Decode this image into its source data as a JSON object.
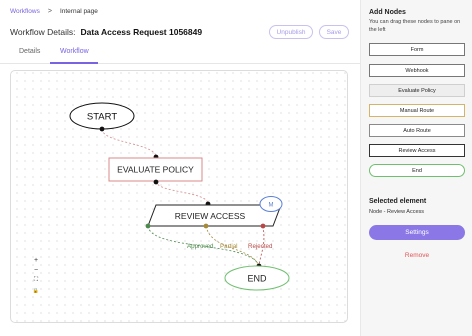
{
  "breadcrumb": {
    "parent": "Workflows",
    "separator": ">",
    "current": "Internal page"
  },
  "header": {
    "title_label": "Workflow Details:",
    "title_value": "Data Access Request 1056849",
    "unpublish_label": "Unpublish",
    "save_label": "Save"
  },
  "tabs": [
    {
      "label": "Details"
    },
    {
      "label": "Workflow"
    }
  ],
  "active_tab": "Workflow",
  "canvas": {
    "nodes": {
      "start": "START",
      "evaluate": "EVALUATE POLICY",
      "review": "REVIEW ACCESS",
      "end": "END",
      "review_badge": "M"
    },
    "edge_labels": {
      "approved": "Approved",
      "partial": "Partial",
      "rejected": "Rejected"
    },
    "zoom": {
      "in": "+",
      "out": "−",
      "fit": "⛶",
      "lock": "🔒"
    }
  },
  "sidebar": {
    "add_nodes_title": "Add Nodes",
    "add_nodes_hint": "You can drag these nodes to pane on the left",
    "node_types": [
      {
        "label": "Form"
      },
      {
        "label": "Webhook"
      },
      {
        "label": "Evaluate Policy"
      },
      {
        "label": "Manual Route"
      },
      {
        "label": "Auto Route"
      },
      {
        "label": "Review Access"
      },
      {
        "label": "End"
      }
    ],
    "selected_title": "Selected element",
    "selected_value": "Node - Review Access",
    "settings_label": "Settings",
    "remove_label": "Remove"
  },
  "colors": {
    "accent": "#7a63e0",
    "approved": "#4e8a4e",
    "partial": "#a58a3a",
    "rejected": "#b84848",
    "evaluate_border": "#d98a8a",
    "review_badge": "#5b7fd6",
    "end_border": "#6fbf6f",
    "manual_route_border": "#d4b36a",
    "remove": "#e25555"
  }
}
